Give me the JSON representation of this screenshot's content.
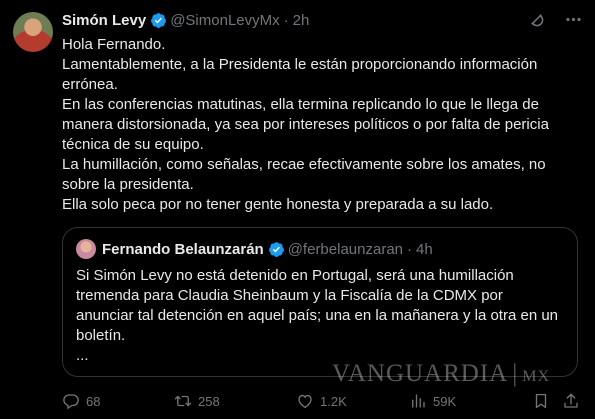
{
  "author": {
    "name": "Simón Levy",
    "handle": "@SimonLevyMx",
    "separator": "·",
    "time": "2h"
  },
  "tweet": {
    "lines": [
      "Hola Fernando.",
      "Lamentablemente, a la Presidenta le están proporcionando información\nerrónea.",
      "En las conferencias matutinas, ella termina replicando lo que le llega de\nmanera distorsionada, ya sea por intereses políticos o por falta de pericia\ntécnica de su equipo.",
      "La humillación, como señalas, recae efectivamente sobre los amates, no\nsobre la presidenta.",
      "Ella solo peca por no tener gente honesta y preparada a su lado."
    ]
  },
  "quote": {
    "name": "Fernando Belaunzarán",
    "handle": "@ferbelaunzaran",
    "separator": "·",
    "time": "4h",
    "lines": [
      "Si Simón Levy no está detenido en Portugal, será una humillación\ntremenda para Claudia Sheinbaum y la Fiscalía de la CDMX por\nanunciar tal detención en aquel país; una en la mañanera y la otra en un\nboletín.",
      "..."
    ]
  },
  "watermark": {
    "brand": "VANGUARDIA",
    "separator": "|",
    "suffix": "MX"
  },
  "actions": {
    "replies": "68",
    "retweets": "258",
    "likes": "1.2K",
    "views": "59K"
  },
  "colors": {
    "background": "#000000",
    "text": "#e7e9ea",
    "muted": "#71767b",
    "verified": "#1d9bf0",
    "border": "#2f3336"
  },
  "icons": [
    "verified-badge-icon",
    "grok-icon",
    "more-icon",
    "reply-icon",
    "retweet-icon",
    "like-icon",
    "views-icon",
    "bookmark-icon",
    "share-icon"
  ]
}
